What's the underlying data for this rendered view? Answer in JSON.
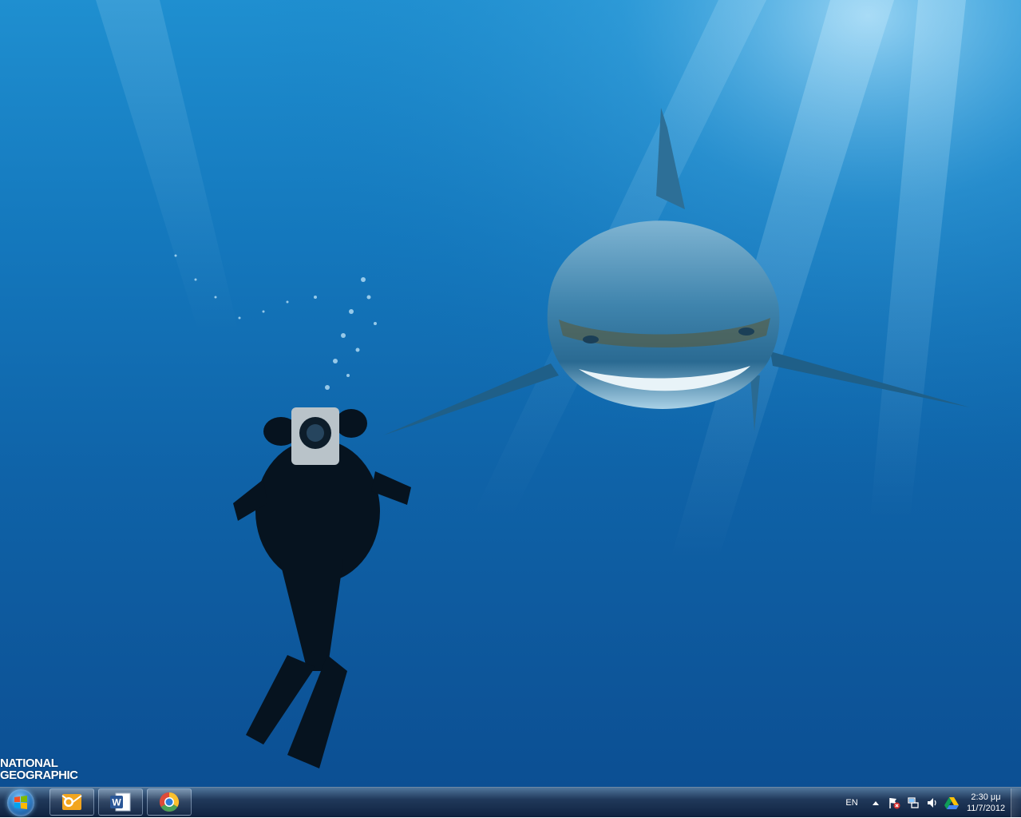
{
  "wallpaper": {
    "watermark_line1": "NATIONAL",
    "watermark_line2": "GEOGRAPHIC"
  },
  "taskbar": {
    "start_icon": "windows-logo-icon",
    "pinned": [
      {
        "name": "outlook",
        "icon": "outlook-icon",
        "color": "#f2a51f"
      },
      {
        "name": "word",
        "icon": "word-icon",
        "color": "#2b5797"
      },
      {
        "name": "chrome",
        "icon": "chrome-icon",
        "color": "#dd4b39"
      }
    ],
    "tray": {
      "language": "EN",
      "icons": [
        "show-hidden-icons-icon",
        "action-center-flag-icon",
        "network-icon",
        "volume-icon",
        "google-drive-icon"
      ]
    },
    "clock": {
      "time": "2:30 μμ",
      "date": "11/7/2012"
    }
  }
}
